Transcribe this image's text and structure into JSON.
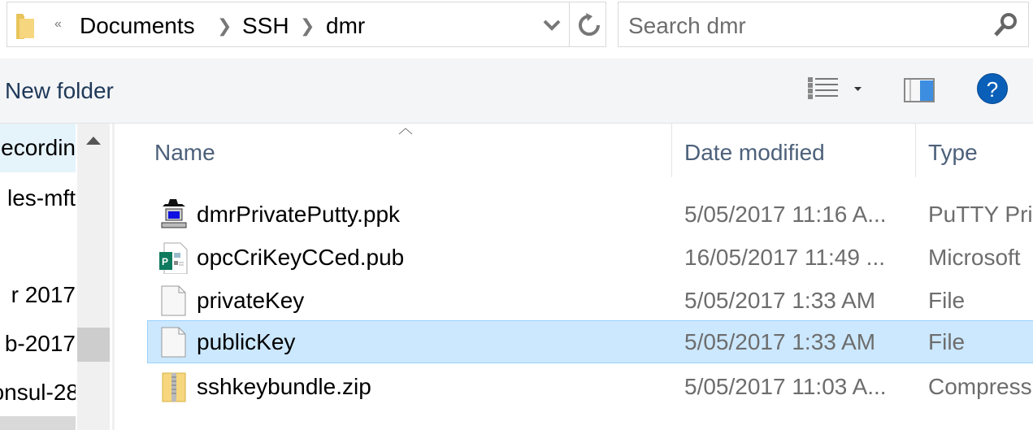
{
  "address": {
    "overflow": "«",
    "crumbs": [
      "Documents",
      "SSH",
      "dmr"
    ]
  },
  "search": {
    "placeholder": "Search dmr"
  },
  "toolbar": {
    "new_folder": "New folder",
    "help": "?"
  },
  "nav": {
    "items": [
      "ecordin",
      "les-mft",
      "r 2017",
      "b-2017",
      "onsul-28"
    ]
  },
  "columns": {
    "name": "Name",
    "date": "Date modified",
    "type": "Type"
  },
  "files": [
    {
      "name": "dmrPrivatePutty.ppk",
      "date": "5/05/2017 11:16 A...",
      "type": "PuTTY Priv",
      "icon": "putty-key-icon"
    },
    {
      "name": "opcCriKeyCCed.pub",
      "date": "16/05/2017 11:49 ...",
      "type": "Microsoft",
      "icon": "publisher-file-icon"
    },
    {
      "name": "privateKey",
      "date": "5/05/2017 1:33 AM",
      "type": "File",
      "icon": "file-icon"
    },
    {
      "name": "publicKey",
      "date": "5/05/2017 1:33 AM",
      "type": "File",
      "icon": "file-icon",
      "selected": true
    },
    {
      "name": "sshkeybundle.zip",
      "date": "5/05/2017 11:03 A...",
      "type": "Compress",
      "icon": "zip-folder-icon"
    }
  ]
}
